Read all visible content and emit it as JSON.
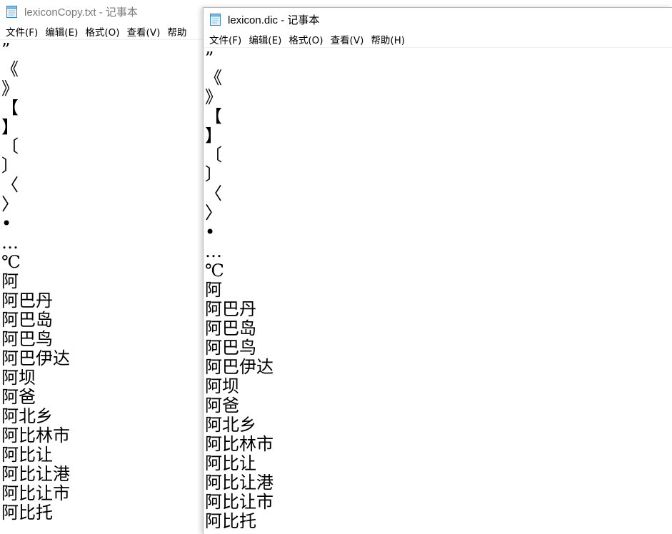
{
  "windows": {
    "back": {
      "title": "lexiconCopy.txt - 记事本",
      "menu": [
        "文件(F)",
        "编辑(E)",
        "格式(O)",
        "查看(V)",
        "帮助"
      ]
    },
    "front": {
      "title": "lexicon.dic - 记事本",
      "menu": [
        "文件(F)",
        "编辑(E)",
        "格式(O)",
        "查看(V)",
        "帮助(H)"
      ]
    }
  },
  "lines": [
    "”",
    "《",
    "》",
    "【",
    "】",
    "〔",
    "〕",
    "〈",
    "〉",
    "•",
    "…",
    "℃",
    "阿",
    "阿巴丹",
    "阿巴岛",
    "阿巴鸟",
    "阿巴伊达",
    "阿坝",
    "阿爸",
    "阿北乡",
    "阿比林市",
    "阿比让",
    "阿比让港",
    "阿比让市",
    "阿比托"
  ],
  "icon": "notepad-icon"
}
